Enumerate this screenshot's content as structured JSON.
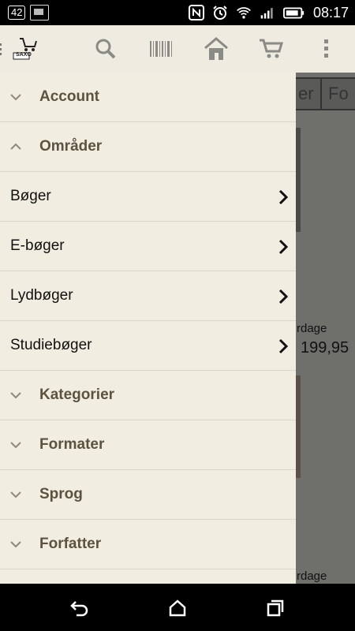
{
  "status_bar": {
    "notification_count": "42",
    "time": "08:17",
    "icons": [
      "image-notification-icon",
      "nfc-icon",
      "alarm-icon",
      "wifi-icon",
      "signal-icon",
      "battery-icon"
    ]
  },
  "toolbar": {
    "logo_text": "SAXO",
    "icons": [
      "menu-icon",
      "search-icon",
      "barcode-icon",
      "home-icon",
      "cart-icon",
      "overflow-menu-icon"
    ]
  },
  "background": {
    "chips": [
      "er",
      "Fo"
    ],
    "delivery_text_1": "rdage",
    "price_1": "199,95",
    "delivery_text_2": "rdage"
  },
  "drawer": {
    "sections": [
      {
        "label": "Account",
        "expanded": false
      },
      {
        "label": "Områder",
        "expanded": true,
        "items": [
          "Bøger",
          "E-bøger",
          "Lydbøger",
          "Studiebøger"
        ]
      },
      {
        "label": "Kategorier",
        "expanded": false
      },
      {
        "label": "Formater",
        "expanded": false
      },
      {
        "label": "Sprog",
        "expanded": false
      },
      {
        "label": "Forfatter",
        "expanded": false
      }
    ]
  },
  "colors": {
    "drawer_bg": "#f2ede1",
    "section_text": "#5d523f",
    "divider": "#dcd6c8",
    "toolbar_bg": "#efebe0"
  }
}
